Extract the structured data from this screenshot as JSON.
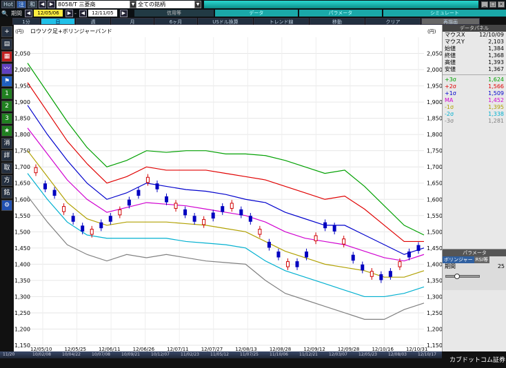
{
  "titlebar": {
    "hot": "Hot",
    "tab2": "注",
    "tab3": "和",
    "symbol": "8058/T 三菱商",
    "sector": "全ての銘柄"
  },
  "row2": {
    "period_label": "期間",
    "date_from": "12/05/06",
    "sep": "-",
    "date_to": "12/11/05",
    "s1": "信用等",
    "s2": "データ",
    "s3": "パラメータ",
    "s4": "シミュレート"
  },
  "timeframes": [
    "1分",
    "日",
    "週",
    "月",
    "6ヶ月",
    "USドル換算",
    "トレンド線",
    "移動",
    "クリア"
  ],
  "chart_data": {
    "type": "line",
    "title": "ロウソク足+ボリンジャーバンド",
    "ylabel": "(円)",
    "ylim": [
      1150,
      2100
    ],
    "yticks": [
      1150,
      1200,
      1250,
      1300,
      1350,
      1400,
      1450,
      1500,
      1550,
      1600,
      1650,
      1700,
      1750,
      1800,
      1850,
      1900,
      1950,
      2000,
      2050
    ],
    "xticks": [
      "12/05/10",
      "12/05/25",
      "12/06/11",
      "12/06/26",
      "12/07/11",
      "12/07/27",
      "12/08/13",
      "12/08/28",
      "12/09/12",
      "12/09/28",
      "12/10/16",
      "12/10/31"
    ],
    "series": [
      {
        "name": "+3σ",
        "color": "#00a000",
        "values": [
          2020,
          1930,
          1840,
          1760,
          1700,
          1720,
          1750,
          1745,
          1750,
          1750,
          1740,
          1740,
          1735,
          1720,
          1700,
          1680,
          1690,
          1640,
          1580,
          1520,
          1490
        ]
      },
      {
        "name": "+2σ",
        "color": "#e00000",
        "values": [
          1960,
          1870,
          1780,
          1710,
          1650,
          1670,
          1700,
          1690,
          1690,
          1690,
          1680,
          1670,
          1660,
          1640,
          1620,
          1600,
          1610,
          1570,
          1520,
          1470,
          1470
        ]
      },
      {
        "name": "+1σ",
        "color": "#0000cc",
        "values": [
          1890,
          1800,
          1720,
          1650,
          1600,
          1620,
          1650,
          1640,
          1630,
          1625,
          1615,
          1600,
          1590,
          1560,
          1540,
          1520,
          1520,
          1490,
          1460,
          1430,
          1450
        ]
      },
      {
        "name": "MA",
        "color": "#d000d0",
        "values": [
          1820,
          1740,
          1660,
          1600,
          1560,
          1575,
          1590,
          1585,
          1580,
          1570,
          1560,
          1550,
          1530,
          1500,
          1480,
          1470,
          1460,
          1440,
          1420,
          1410,
          1430
        ]
      },
      {
        "name": "-1σ",
        "color": "#b0a000",
        "values": [
          1750,
          1670,
          1590,
          1540,
          1520,
          1530,
          1530,
          1530,
          1525,
          1520,
          1510,
          1500,
          1470,
          1440,
          1420,
          1400,
          1390,
          1380,
          1360,
          1360,
          1380
        ]
      },
      {
        "name": "-2σ",
        "color": "#00b0d0",
        "values": [
          1680,
          1600,
          1530,
          1490,
          1480,
          1480,
          1480,
          1480,
          1470,
          1465,
          1460,
          1450,
          1410,
          1380,
          1360,
          1340,
          1320,
          1300,
          1300,
          1310,
          1330
        ]
      },
      {
        "name": "-3σ",
        "color": "#808080",
        "values": [
          1610,
          1530,
          1460,
          1430,
          1410,
          1430,
          1420,
          1430,
          1420,
          1410,
          1405,
          1400,
          1350,
          1310,
          1290,
          1270,
          1250,
          1230,
          1230,
          1260,
          1280
        ]
      }
    ],
    "candles": [
      1690,
      1640,
      1620,
      1570,
      1540,
      1510,
      1500,
      1520,
      1540,
      1560,
      1590,
      1620,
      1660,
      1640,
      1600,
      1580,
      1560,
      1540,
      1530,
      1550,
      1570,
      1580,
      1560,
      1540,
      1500,
      1460,
      1430,
      1400,
      1400,
      1430,
      1480,
      1520,
      1510,
      1470,
      1420,
      1390,
      1370,
      1360,
      1370,
      1400,
      1430,
      1450
    ]
  },
  "panel": {
    "title": "データパネル",
    "rows": [
      {
        "k": "マウスX",
        "v": "12/10/09"
      },
      {
        "k": "マウスY",
        "v": "2,103"
      },
      {
        "k": "始値",
        "v": "1,384"
      },
      {
        "k": "終値",
        "v": "1,368"
      },
      {
        "k": "高値",
        "v": "1,393"
      },
      {
        "k": "安値",
        "v": "1,367"
      }
    ],
    "bands": [
      {
        "k": "+3σ",
        "v": "1,624",
        "c": "#00a000"
      },
      {
        "k": "+2σ",
        "v": "1,566",
        "c": "#e00000"
      },
      {
        "k": "+1σ",
        "v": "1,509",
        "c": "#0000cc"
      },
      {
        "k": "MA",
        "v": "1,452",
        "c": "#d000d0"
      },
      {
        "k": "-1σ",
        "v": "1,395",
        "c": "#b0a000"
      },
      {
        "k": "-2σ",
        "v": "1,338",
        "c": "#00b0d0"
      },
      {
        "k": "-3σ",
        "v": "1,281",
        "c": "#808080"
      }
    ]
  },
  "param": {
    "title": "パラメータ",
    "tab1": "ボリンジャー",
    "tab2": "RSI等",
    "period_label": "期間",
    "period_value": "25"
  },
  "bottom": {
    "logo": "カブドットコム証券",
    "strip": [
      "11/20",
      "10/02/08",
      "10/04/22",
      "10/07/08",
      "10/09/21",
      "10/12/07",
      "11/02/23",
      "11/05/12",
      "11/07/25",
      "11/10/06",
      "11/12/21",
      "12/03/07",
      "12/05/23",
      "12/08/03",
      "12/10/17"
    ]
  }
}
